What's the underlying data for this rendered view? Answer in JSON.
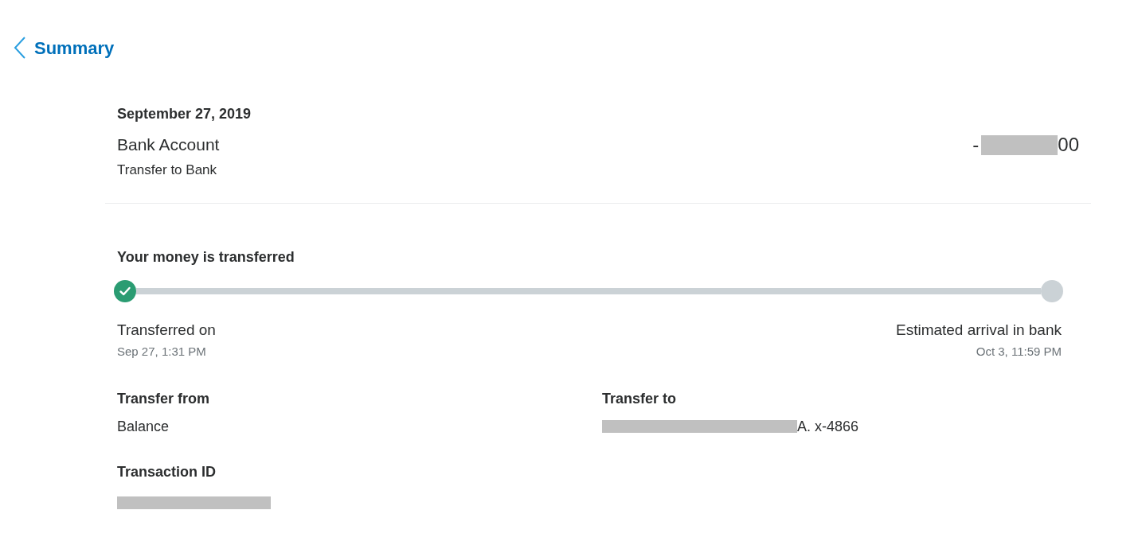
{
  "back_link": {
    "label": "Summary"
  },
  "transaction": {
    "date": "September 27, 2019",
    "name": "Bank Account",
    "type": "Transfer to Bank",
    "amount": {
      "prefix": "-",
      "suffix": "00",
      "redacted": true
    }
  },
  "status": {
    "title": "Your money is transferred",
    "steps": [
      {
        "label": "Transferred on",
        "time": "Sep 27, 1:31 PM",
        "done": true
      },
      {
        "label": "Estimated arrival in bank",
        "time": "Oct 3, 11:59 PM",
        "done": false
      }
    ]
  },
  "details": [
    {
      "label": "Transfer from",
      "value": "Balance"
    },
    {
      "label": "Transfer to",
      "value": "A. x-4866",
      "redacted": true
    },
    {
      "label": "Transaction ID",
      "redacted": true
    }
  ]
}
